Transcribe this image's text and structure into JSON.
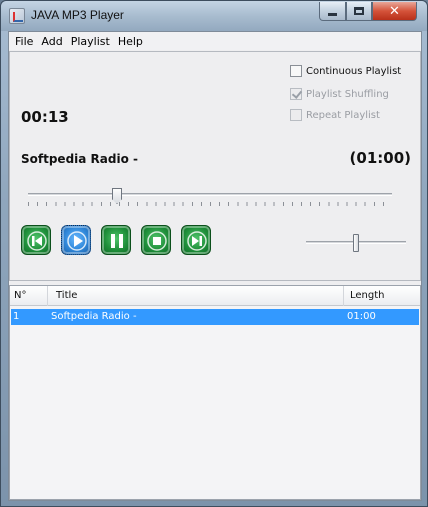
{
  "window": {
    "title": "JAVA MP3 Player",
    "controls": {
      "minimize_icon": "minimize-icon",
      "maximize_icon": "maximize-icon",
      "close_icon": "close-icon",
      "close_glyph": "✕"
    }
  },
  "menu": {
    "items": [
      {
        "label": "File"
      },
      {
        "label": "Add"
      },
      {
        "label": "Playlist"
      },
      {
        "label": "Help"
      }
    ]
  },
  "player": {
    "elapsed": "00:13",
    "song_title": "Softpedia Radio -",
    "song_length": "(01:00)",
    "seek_fraction": 0.23,
    "volume_fraction": 0.5
  },
  "options": {
    "continuous_playlist": {
      "label": "Continuous Playlist",
      "checked": false,
      "enabled": true
    },
    "playlist_shuffling": {
      "label": "Playlist Shuffling",
      "checked": true,
      "enabled": false
    },
    "repeat_playlist": {
      "label": "Repeat Playlist",
      "checked": false,
      "enabled": false
    }
  },
  "transport": [
    {
      "name": "previous-button",
      "icon": "previous-icon"
    },
    {
      "name": "play-button",
      "icon": "play-icon",
      "focused": true
    },
    {
      "name": "pause-button",
      "icon": "pause-icon"
    },
    {
      "name": "stop-button",
      "icon": "stop-icon"
    },
    {
      "name": "next-button",
      "icon": "next-icon"
    }
  ],
  "playlist": {
    "columns": [
      "N°",
      "Title",
      "Length"
    ],
    "rows": [
      {
        "num": "1",
        "title": "Softpedia Radio -",
        "length": "01:00",
        "selected": true
      }
    ]
  },
  "colors": {
    "selection": "#3399ff",
    "transport_green": "#1f8f3a",
    "transport_focus_blue": "#2f86d8"
  }
}
